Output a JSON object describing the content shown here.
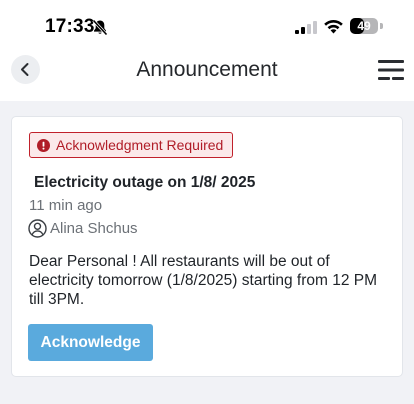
{
  "status_bar": {
    "time": "17:33",
    "battery": "49",
    "battery_level": 0.49,
    "icons": [
      "bell-muted-icon",
      "signal-icon",
      "wifi-icon",
      "battery-icon"
    ]
  },
  "header": {
    "title": "Announcement",
    "back_icon": "chevron-left-icon",
    "menu_icon": "menu-icon"
  },
  "announcement": {
    "badge": "Acknowledgment Required",
    "title": "Electricity outage on 1/8/ 2025",
    "time_ago": "11 min ago",
    "author": "Alina Shchus",
    "body": "Dear Personal ! All restaurants will be out of\nelectricity tomorrow (1/8/2025) starting from 12 PM\ntill  3PM.",
    "action_label": "Acknowledge"
  },
  "colors": {
    "accent": "#5aaadd",
    "badge_border": "#c0212b",
    "badge_background": "#fbe9ea",
    "page_background": "#f1f2f6"
  }
}
